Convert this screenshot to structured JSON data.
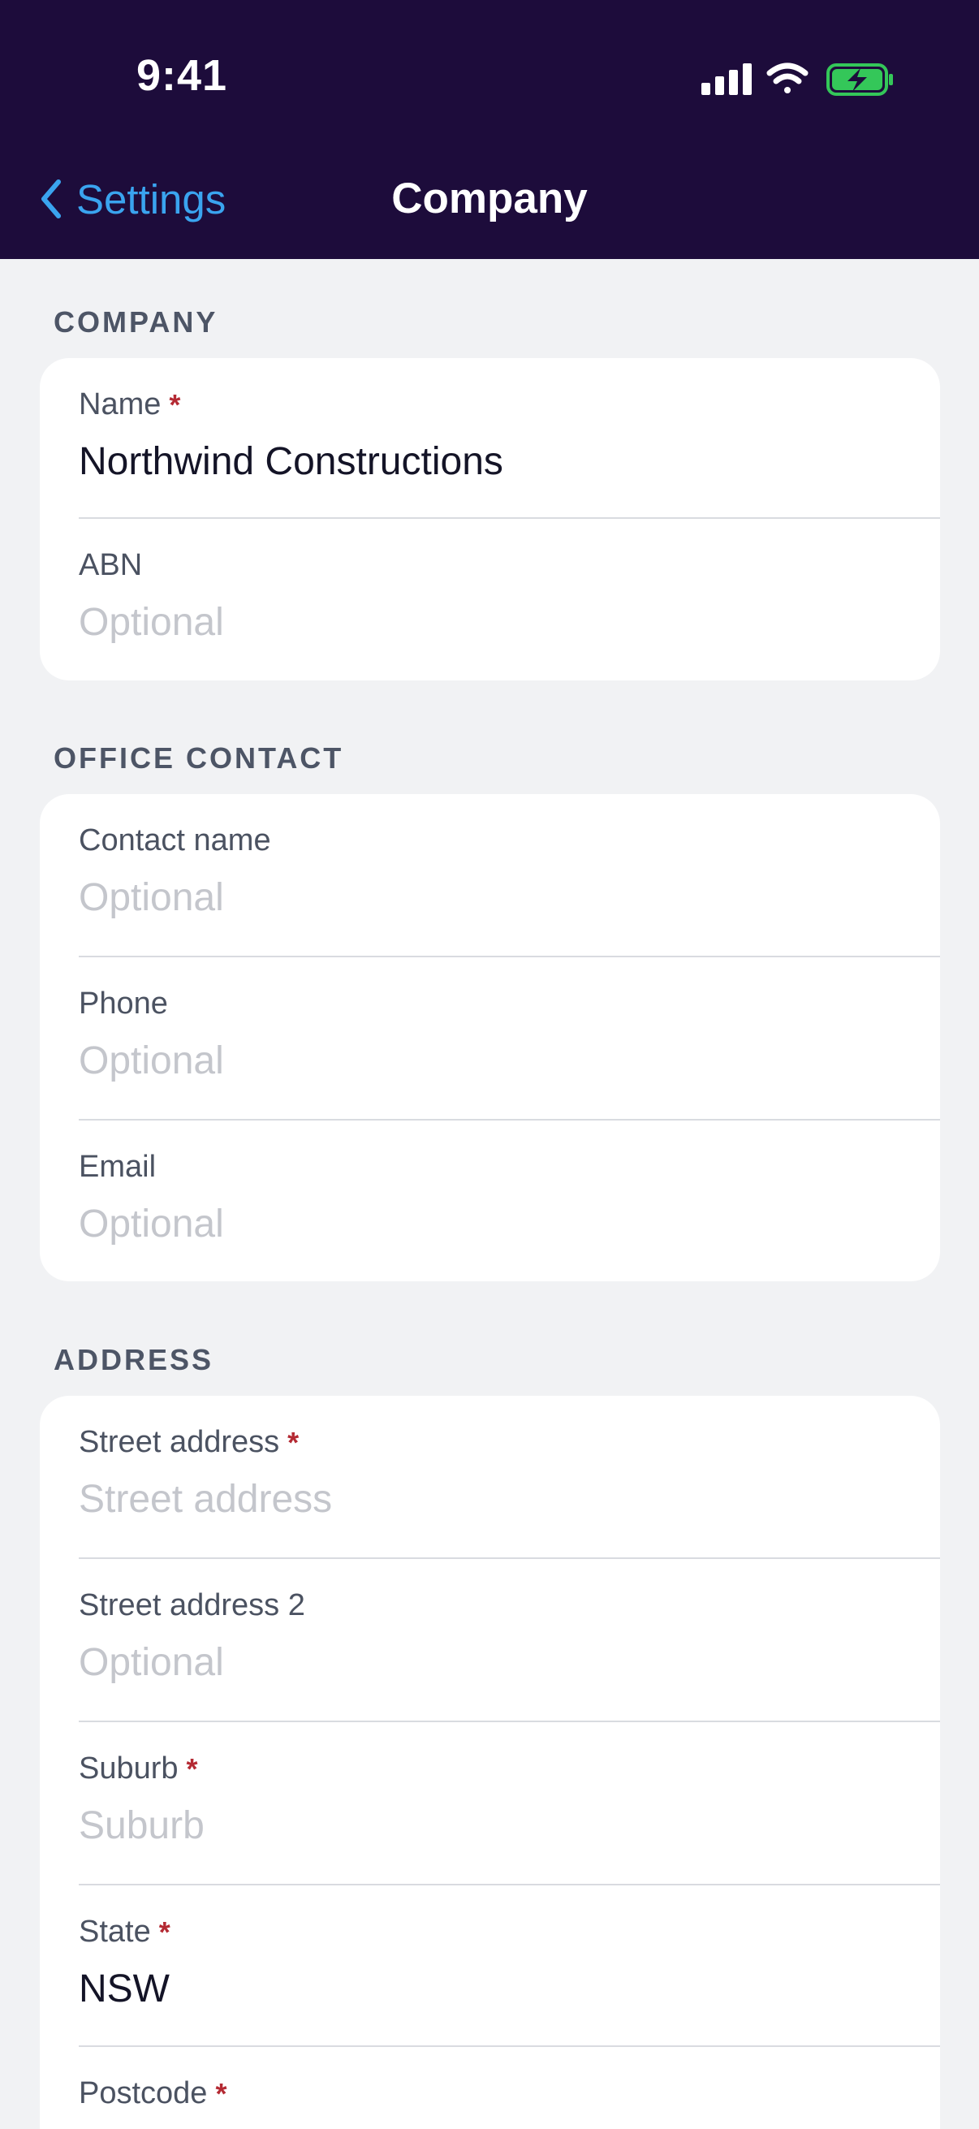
{
  "status_bar": {
    "time": "9:41",
    "icons": [
      "cellular-signal-icon",
      "wifi-icon",
      "battery-charging-icon"
    ]
  },
  "nav": {
    "back_label": "Settings",
    "title": "Company"
  },
  "sections": {
    "company": {
      "header": "COMPANY",
      "fields": {
        "name": {
          "label": "Name",
          "required": true,
          "value": "Northwind Constructions"
        },
        "abn": {
          "label": "ABN",
          "required": false,
          "placeholder": "Optional"
        }
      }
    },
    "office_contact": {
      "header": "OFFICE CONTACT",
      "fields": {
        "contact_name": {
          "label": "Contact name",
          "required": false,
          "placeholder": "Optional"
        },
        "phone": {
          "label": "Phone",
          "required": false,
          "placeholder": "Optional"
        },
        "email": {
          "label": "Email",
          "required": false,
          "placeholder": "Optional"
        }
      }
    },
    "address": {
      "header": "ADDRESS",
      "fields": {
        "street": {
          "label": "Street address",
          "required": true,
          "placeholder": "Street address"
        },
        "street2": {
          "label": "Street address 2",
          "required": false,
          "placeholder": "Optional"
        },
        "suburb": {
          "label": "Suburb",
          "required": true,
          "placeholder": "Suburb"
        },
        "state": {
          "label": "State",
          "required": true,
          "value": "NSW"
        },
        "postcode": {
          "label": "Postcode",
          "required": true
        }
      }
    }
  },
  "required_marker": "*",
  "colors": {
    "header_bg": "#1d0c3b",
    "accent": "#3aa4ef",
    "required": "#b42a33",
    "page_bg": "#f1f2f4",
    "battery": "#34c759"
  }
}
